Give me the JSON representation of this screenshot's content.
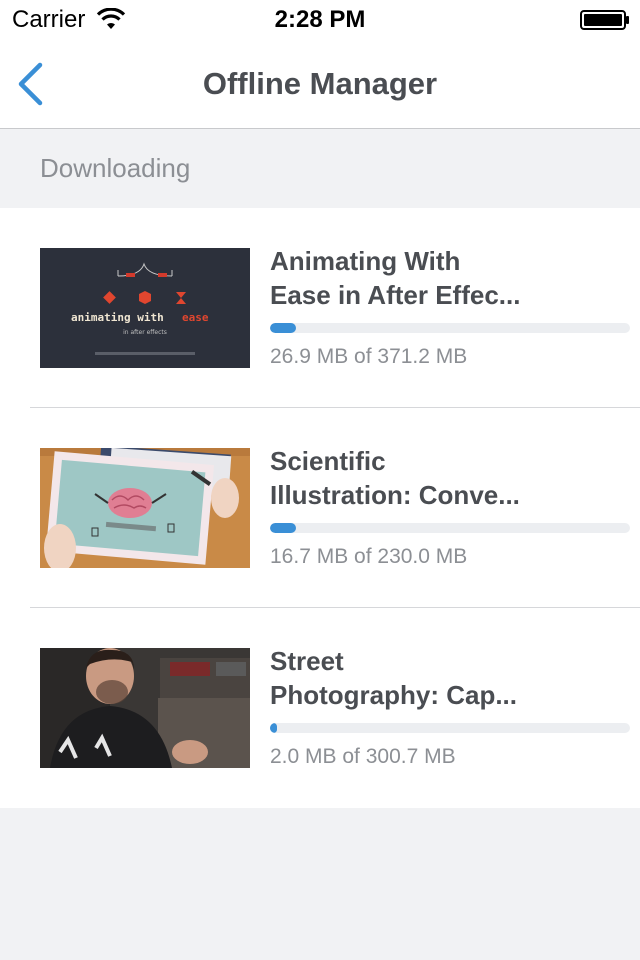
{
  "status_bar": {
    "carrier": "Carrier",
    "time": "2:28 PM",
    "wifi_icon": "wifi-icon",
    "battery_icon": "battery-icon"
  },
  "nav": {
    "title": "Offline Manager",
    "back_icon": "chevron-left-icon"
  },
  "section": {
    "title": "Downloading"
  },
  "colors": {
    "accent": "#3a8fd6",
    "title_text": "#4a4d52",
    "secondary_text": "#8c8f94",
    "background": "#f1f2f4"
  },
  "downloads": [
    {
      "title_line1": "Animating With",
      "title_line2": "Ease in After Effec...",
      "size_text": "26.9 MB of 371.2 MB",
      "progress": 0.072,
      "thumb_text": "animating with",
      "thumb_text_accent": "ease",
      "thumb_subtitle": "in after effects"
    },
    {
      "title_line1": "Scientific",
      "title_line2": "Illustration: Conve...",
      "size_text": "16.7 MB of 230.0 MB",
      "progress": 0.073
    },
    {
      "title_line1": "Street",
      "title_line2": "Photography: Cap...",
      "size_text": "2.0 MB of 300.7 MB",
      "progress": 0.02
    }
  ]
}
